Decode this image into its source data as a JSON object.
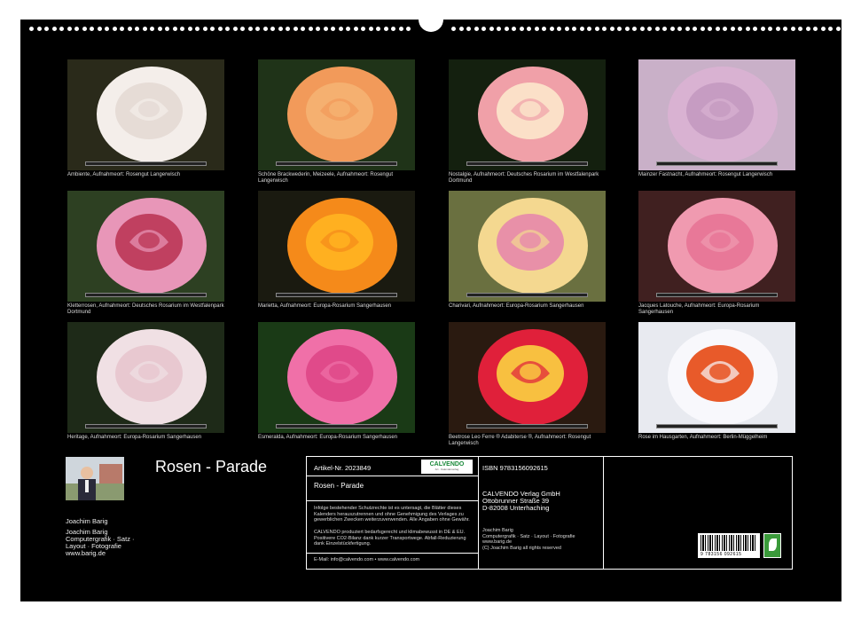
{
  "calendar": {
    "title": "Rosen - Parade",
    "author": {
      "name": "Joachim Barig",
      "lines": [
        "Joachim Barig",
        "Computergrafik · Satz ·",
        "Layout · Fotografie",
        "www.barig.de"
      ]
    }
  },
  "photos": [
    {
      "caption": "Ambiente, Aufnahmeort: Rosengut Langerwisch",
      "colors": [
        "#2a2a1a",
        "#f4eeea",
        "#e6dcd6"
      ]
    },
    {
      "caption": "Schöne Brackwederin, Meizeele, Aufnahmeort: Rosengut Langerwisch",
      "colors": [
        "#1f3318",
        "#f29a5a",
        "#f5b070"
      ]
    },
    {
      "caption": "Nostalgie, Aufnahmeort: Deutsches Rosarium im Westfalenpark Dortmund",
      "colors": [
        "#14200f",
        "#f0a0a8",
        "#fbe0c8"
      ]
    },
    {
      "caption": "Mainzer Fastnacht, Aufnahmeort: Rosengut Langerwisch",
      "colors": [
        "#c9b0c8",
        "#d9b2d2",
        "#c69cc2"
      ]
    },
    {
      "caption": "Kletterrosen, Aufnahmeort: Deutsches Rosarium im Westfalenpark Dortmund",
      "colors": [
        "#2d4022",
        "#e896b8",
        "#c04060"
      ]
    },
    {
      "caption": "Marietta, Aufnahmeort: Europa-Rosarium Sangerhausen",
      "colors": [
        "#1a1a10",
        "#f58a1a",
        "#ffb020"
      ]
    },
    {
      "caption": "Charivari, Aufnahmeort: Europa-Rosarium Sangerhausen",
      "colors": [
        "#6a7040",
        "#f4d890",
        "#e890a8"
      ]
    },
    {
      "caption": "Jacques Latouche, Aufnahmeort: Europa-Rosarium Sangerhausen",
      "colors": [
        "#402020",
        "#f09ab0",
        "#e87898"
      ]
    },
    {
      "caption": "Heritage, Aufnahmeort: Europa-Rosarium Sangerhausen",
      "colors": [
        "#1e2a18",
        "#f0e0e4",
        "#e8c8d0"
      ]
    },
    {
      "caption": "Esmeralda, Aufnahmeort: Europa-Rosarium Sangerhausen",
      "colors": [
        "#1a3a16",
        "#f070a8",
        "#e04a8a"
      ]
    },
    {
      "caption": "Beetrose Leo Ferre ® Adabiterse ®, Aufnahmeort: Rosengut Langerwisch",
      "colors": [
        "#2a1a10",
        "#e0203a",
        "#f8c040"
      ]
    },
    {
      "caption": "Rose im Hausgarten, Aufnahmeort: Berlin-Müggelheim",
      "colors": [
        "#e8eaf0",
        "#f8f8fc",
        "#e85a2a"
      ]
    }
  ],
  "info": {
    "article_label": "Artikel-Nr. 2023849",
    "logo_text": "CALVENDO",
    "logo_sub": "Art · Kalenderverlag",
    "title": "Rosen - Parade",
    "legal_text": "Infolge bestehender Schutzrechte ist es untersagt, die Blätter dieses Kalenders herauszutrennen und ohne Genehmigung des Verlages zu gewerblichen Zwecken weiterzuverwenden. Alle Angaben ohne Gewähr.",
    "eco_text": "CALVENDO produziert bedarfsgerecht und klimabewusst in DE & EU. Positivere CO2-Bilanz dank kurzer Transportwege. Abfall-Reduzierung dank Einzelstückfertigung.",
    "contact": "E-Mail: info@calvendo.com • www.calvendo.com",
    "isbn": "ISBN 9783156092615",
    "publisher": [
      "CALVENDO Verlag GmbH",
      "Ottobrunner Straße 39",
      "D-82008 Unterhaching"
    ],
    "credits": [
      "Joachim Barig",
      "Computergrafik · Satz · Layout · Fotografie",
      "www.barig.de",
      "(C) Joachim Barig all rights reserved"
    ],
    "barcode_number": "9 783156 092615"
  }
}
